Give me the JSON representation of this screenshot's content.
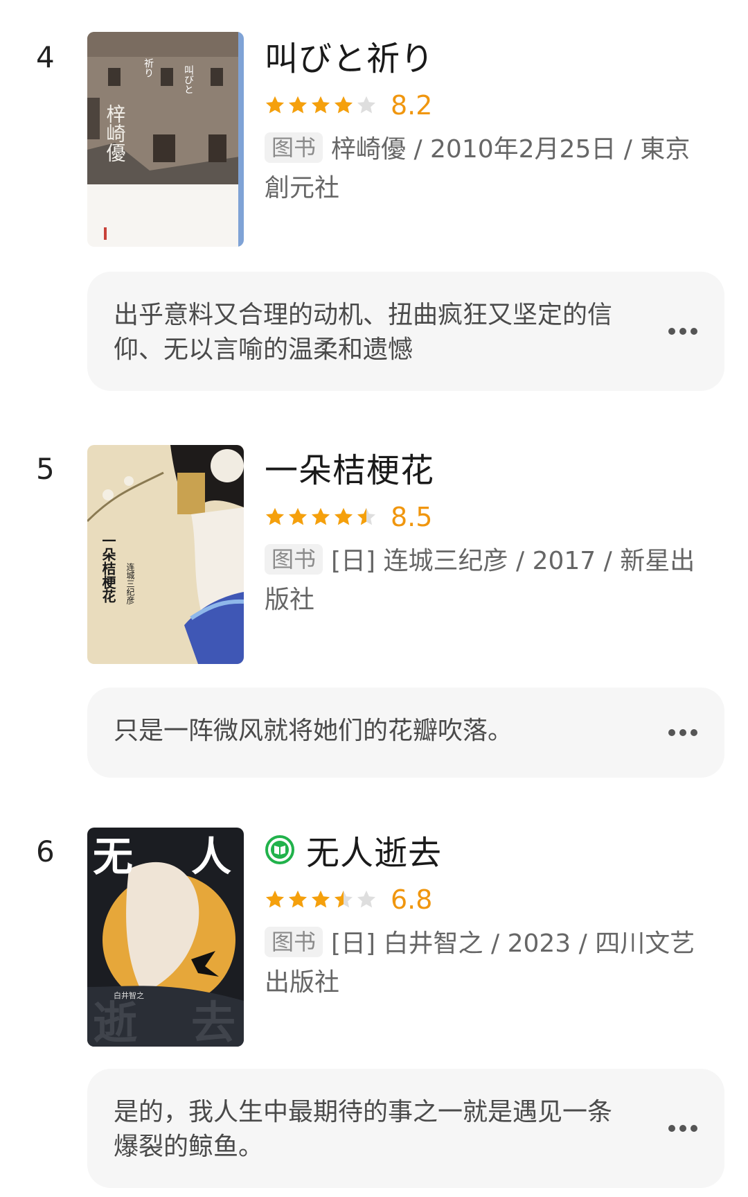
{
  "books": [
    {
      "rank": "4",
      "title": "叫びと祈り",
      "score": "8.2",
      "rating": 4.0,
      "badge": "图书",
      "meta": "梓崎優 / 2010年2月25日 / 東京創元社",
      "quote": "出乎意料又合理的动机、扭曲疯狂又坚定的信仰、无以言喻的温柔和遗憾",
      "ebook": false,
      "cover_text": {
        "top_right": "叫びと",
        "top_left": "祈り",
        "author": "梓崎優"
      }
    },
    {
      "rank": "5",
      "title": "一朵桔梗花",
      "score": "8.5",
      "rating": 4.5,
      "badge": "图书",
      "meta": "[日] 连城三纪彦 / 2017 / 新星出版社",
      "quote": "只是一阵微风就将她们的花瓣吹落。",
      "ebook": false,
      "cover_text": {
        "title": "一朵桔梗花",
        "author": "连城三纪彦"
      }
    },
    {
      "rank": "6",
      "title": "无人逝去",
      "score": "6.8",
      "rating": 3.5,
      "badge": "图书",
      "meta": "[日] 白井智之 / 2023 / 四川文艺出版社",
      "quote": "是的，我人生中最期待的事之一就是遇见一条爆裂的鲸鱼。",
      "ebook": true,
      "cover_text": {
        "top_left": "无",
        "top_right": "人",
        "bottom_left": "逝",
        "bottom_right": "去",
        "author": "白井智之"
      }
    }
  ],
  "colors": {
    "star": "#f5a00c",
    "star_empty": "#dedede",
    "score": "#f0960e",
    "ebook": "#21b24b"
  }
}
